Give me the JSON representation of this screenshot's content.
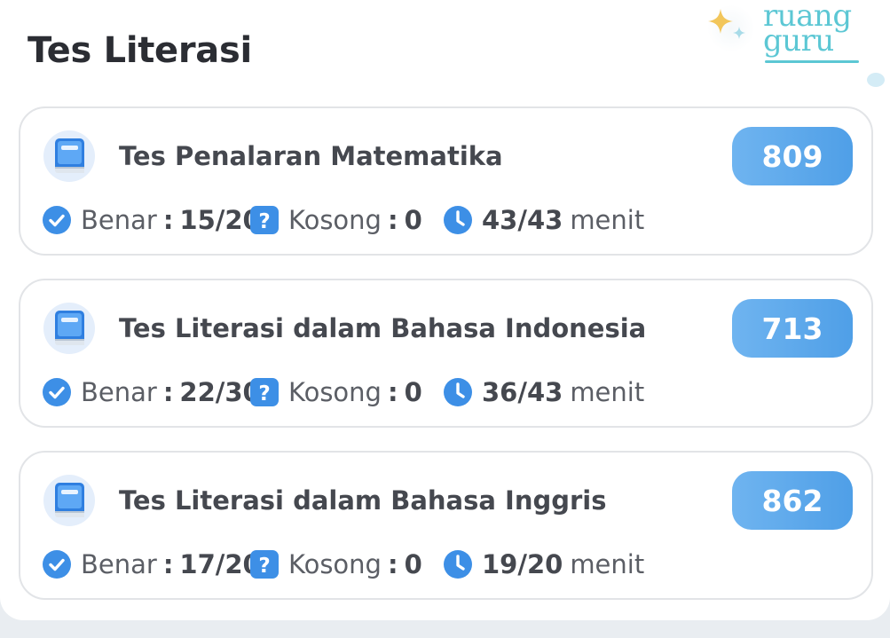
{
  "page": {
    "title": "Tes Literasi"
  },
  "logo": {
    "line1": "ruang",
    "line2": "guru"
  },
  "labels": {
    "benar": "Benar",
    "kosong": "Kosong",
    "separator": ":",
    "unit": "menit"
  },
  "tests": [
    {
      "name": "Tes Penalaran Matematika",
      "score": "809",
      "benar": "15/20",
      "kosong": "0",
      "time": "43/43"
    },
    {
      "name": "Tes Literasi dalam Bahasa Indonesia",
      "score": "713",
      "benar": "22/30",
      "kosong": "0",
      "time": "36/43"
    },
    {
      "name": "Tes Literasi dalam Bahasa Inggris",
      "score": "862",
      "benar": "17/20",
      "kosong": "0",
      "time": "19/20"
    }
  ],
  "colors": {
    "accent": "#4f9fe7",
    "badge_start": "#6fb4f0",
    "logo": "#5cc7d4",
    "sparkle": "#f2c65b"
  }
}
